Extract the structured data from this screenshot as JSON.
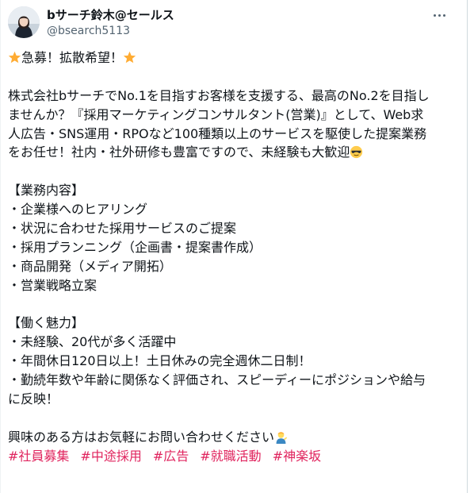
{
  "author": {
    "display_name": "bサーチ鈴木@セールス",
    "handle": "@bsearch5113"
  },
  "post": {
    "lines": [
      "急募！拡散希望！",
      "",
      "株式会社bサーチでNo.1を目指すお客様を支援する、最高のNo.2を目指しませんか？『採用マーケティングコンサルタント(営業)』として、Web求人広告・SNS運用・RPOなど100種類以上のサービスを駆使した提案業務をお任せ！社内・社外研修も豊富ですので、未経験も大歓迎",
      "",
      "【業務内容】",
      "・企業様へのヒアリング",
      "・状況に合わせた採用サービスのご提案",
      "・採用プランニング（企画書・提案書作成）",
      "・商品開発（メディア開拓）",
      "・営業戦略立案",
      "",
      "【働く魅力】",
      "・未経験、20代が多く活躍中",
      "・年間休日120日以上！土日休みの完全週休二日制！",
      "・勤続年数や年齢に関係なく評価され、スピーディーにポジションや給与に反映！",
      "",
      "興味のある方はお気軽にお問い合わせください"
    ],
    "hashtags": [
      "#社員募集",
      "#中途採用",
      "#広告",
      "#就職活動",
      "#神楽坂"
    ]
  },
  "display_lines": {
    "l1": "急募！拡散希望！",
    "p1": "株式会社bサーチでNo.1を目指すお客様を支援する、最高のNo.2を目指し",
    "p2": "ませんか？『採用マーケティングコンサルタント(営業)』として、Web求",
    "p3": "人広告・SNS運用・RPOなど100種類以上のサービスを駆使した提案業務",
    "p4": "をお任せ！社内・社外研修も豊富ですので、未経験も大歓迎",
    "h1": "【業務内容】",
    "b1": "・企業様へのヒアリング",
    "b2": "・状況に合わせた採用サービスのご提案",
    "b3": "・採用プランニング（企画書・提案書作成）",
    "b4": "・商品開発（メディア開拓）",
    "b5": "・営業戦略立案",
    "h2": "【働く魅力】",
    "c1": "・未経験、20代が多く活躍中",
    "c2": "・年間休日120日以上！土日休みの完全週休二日制！",
    "c3a": "・勤続年数や年齢に関係なく評価され、スピーディーにポジションや給与",
    "c3b": "に反映！",
    "end": "興味のある方はお気軽にお問い合わせください"
  },
  "icons": {
    "star": "star-emoji",
    "sunglasses": "sunglasses-emoji",
    "person": "person-tipping-hand-emoji",
    "more": "more-options-icon"
  },
  "colors": {
    "text": "#0f1419",
    "secondary": "#536471",
    "hashtag": "#e0245e"
  }
}
